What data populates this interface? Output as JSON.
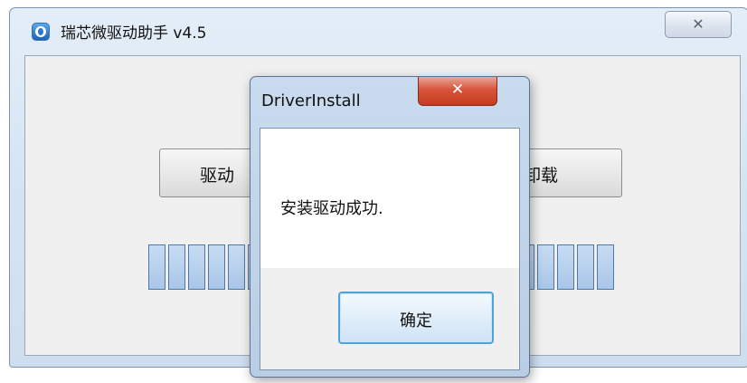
{
  "main_window": {
    "title": "瑞芯微驱动助手 v4.5",
    "close_label": "✕",
    "install_button_label": "驱动",
    "uninstall_button_label": "卸载"
  },
  "dialog": {
    "title": "DriverInstall",
    "close_label": "✕",
    "message": "安装驱动成功.",
    "ok_label": "确定"
  },
  "icons": {
    "app_icon": "app-logo-icon",
    "close": "close-icon"
  },
  "colors": {
    "progress_segment": "#b4cfee",
    "dialog_close": "#d8533a",
    "ok_border": "#4fa3dc"
  }
}
